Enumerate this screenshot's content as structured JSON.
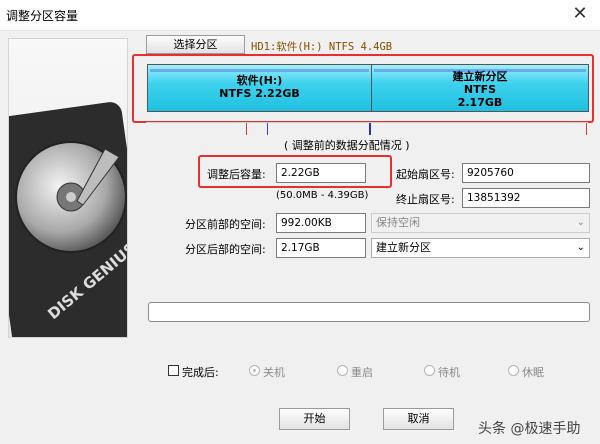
{
  "window": {
    "title": "调整分区容量"
  },
  "toolbar": {
    "select_partition_label": "选择分区",
    "disk_info": "HD1:软件(H:) NTFS 4.4GB"
  },
  "partitions": [
    {
      "name": "软件(H:)",
      "detail": "NTFS 2.22GB"
    },
    {
      "name": "建立新分区",
      "fs": "NTFS",
      "size": "2.17GB"
    }
  ],
  "layout_title": "( 调整前的数据分配情况 )",
  "form": {
    "resize_label": "调整后容量:",
    "resize_value": "2.22GB",
    "range_text": "(50.0MB - 4.39GB)",
    "start_sector_label": "起始扇区号:",
    "start_sector_value": "9205760",
    "end_sector_label": "终止扇区号:",
    "end_sector_value": "13851392",
    "before_space_label": "分区前部的空间:",
    "before_space_value": "992.00KB",
    "before_space_option": "保持空闲",
    "after_space_label": "分区后部的空间:",
    "after_space_value": "2.17GB",
    "after_space_option": "建立新分区"
  },
  "after_complete": {
    "checkbox_label": "完成后:",
    "options": [
      "关机",
      "重启",
      "待机",
      "休眠"
    ]
  },
  "buttons": {
    "start": "开始",
    "cancel": "取消"
  },
  "watermark": "头条 @极速手助",
  "logo_text": "DISK GENIUS",
  "colors": {
    "highlight_red": "#e53030",
    "partition_fill": "#2ec9e8"
  }
}
